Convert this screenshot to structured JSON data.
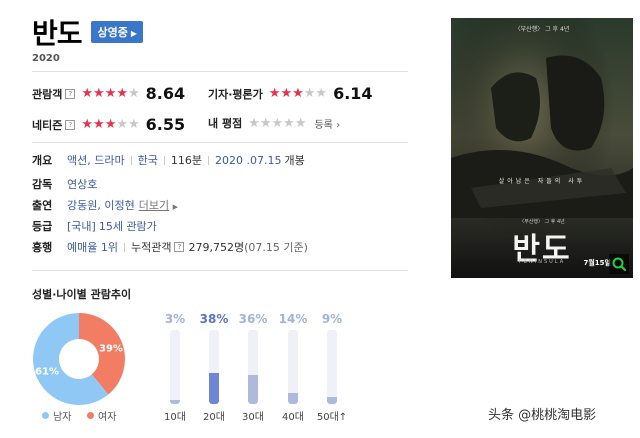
{
  "movie": {
    "title": "반도",
    "status": "상영중",
    "year": "2020"
  },
  "ratings": {
    "audience": {
      "label": "관람객",
      "score": "8.64",
      "stars_filled": 4.3
    },
    "critic": {
      "label": "기자·평론가",
      "score": "6.14",
      "stars_filled": 3.1
    },
    "netizen": {
      "label": "네티즌",
      "score": "6.55",
      "stars_filled": 3.3
    },
    "my": {
      "label": "내 평점",
      "action": "등록",
      "stars_filled": 0
    }
  },
  "info": {
    "overview_label": "개요",
    "genre": "액션, 드라마",
    "country": "한국",
    "runtime": "116분",
    "release_date": "2020 .07.15",
    "release_suffix": "개봉",
    "director_label": "감독",
    "director": "연상호",
    "cast_label": "출연",
    "cast": "강동원, 이정현",
    "cast_more": "더보기",
    "grade_label": "등급",
    "grade_prefix": "[국내]",
    "grade": "15세 관람가",
    "boxoffice_label": "흥행",
    "reservation": "예매율 1위",
    "cumulative_label": "누적관객",
    "cumulative": "279,752명",
    "cumulative_date": "(07.15 기준)"
  },
  "poster": {
    "top_text": "〈부산행〉 그 후 4년",
    "tagline": "살아남은 자들의 사투",
    "sub_text": "〈부산행〉 그 후 4년",
    "title": "반도",
    "title_en": "PENINSULA",
    "date": "7월15일"
  },
  "demographics": {
    "section_title": "성별·나이별 관람추이",
    "gender": [
      {
        "label": "남자",
        "pct": 61,
        "pct_text": "61%",
        "color": "#8fc8f5"
      },
      {
        "label": "여자",
        "pct": 39,
        "pct_text": "39%",
        "color": "#f37d64"
      }
    ],
    "age": [
      {
        "label": "10대",
        "pct": 3,
        "pct_text": "3%"
      },
      {
        "label": "20대",
        "pct": 38,
        "pct_text": "38%",
        "highlight": true
      },
      {
        "label": "30대",
        "pct": 36,
        "pct_text": "36%"
      },
      {
        "label": "40대",
        "pct": 14,
        "pct_text": "14%"
      },
      {
        "label": "50대↑",
        "pct": 9,
        "pct_text": "9%"
      }
    ]
  },
  "watermark": "头条 @桃桃淘电影"
}
